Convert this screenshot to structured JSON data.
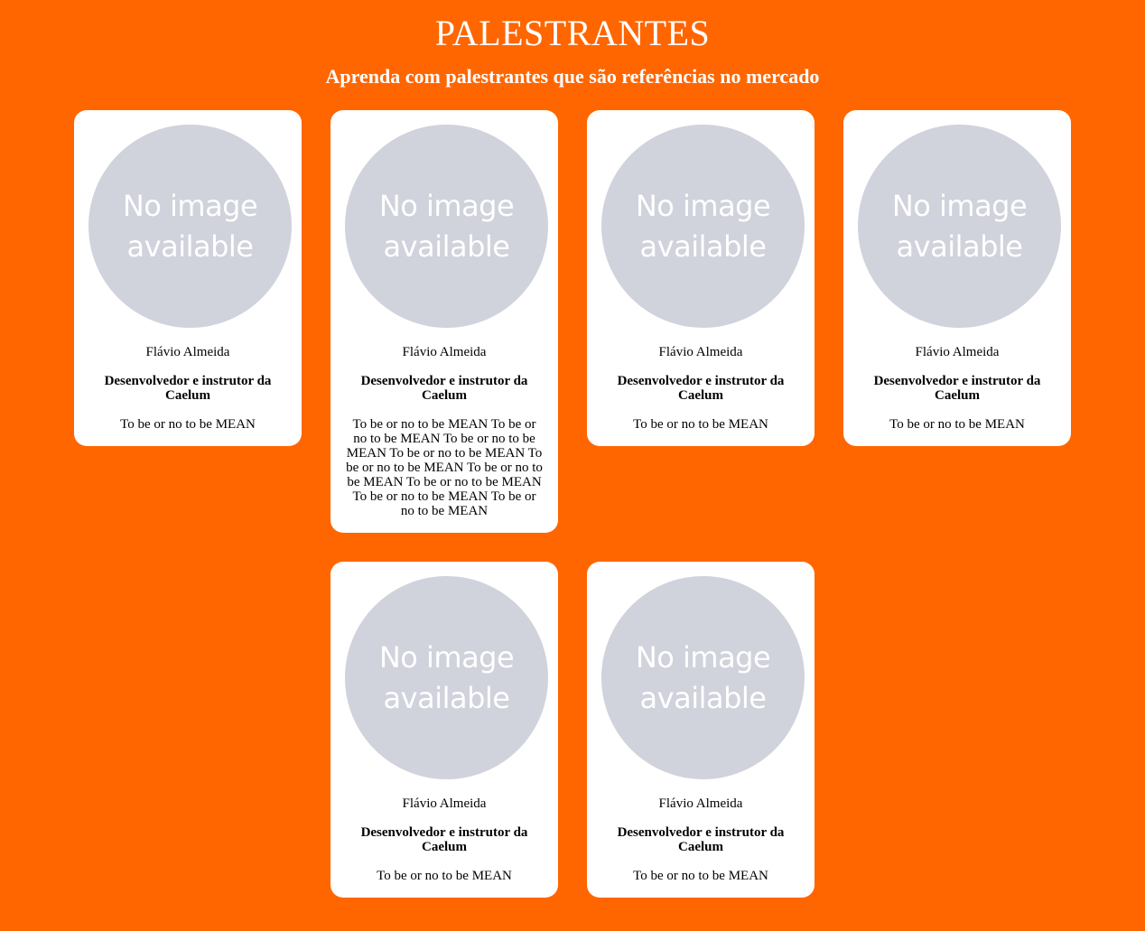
{
  "header": {
    "title": "PALESTRANTES",
    "subtitle": "Aprenda com palestrantes que são referências no mercado"
  },
  "colors": {
    "background": "#ff6600",
    "card": "#ffffff",
    "avatar_placeholder": "#d0d2dc"
  },
  "speakers": [
    {
      "avatar_icon": "no-image-placeholder",
      "avatar_line1": "No image",
      "avatar_line2": "available",
      "name": "Flávio Almeida",
      "role": "Desenvolvedor e instrutor da Caelum",
      "talk": "To be or no to be MEAN"
    },
    {
      "avatar_icon": "no-image-placeholder",
      "avatar_line1": "No image",
      "avatar_line2": "available",
      "name": "Flávio Almeida",
      "role": "Desenvolvedor e instrutor da Caelum",
      "talk": "To be or no to be MEAN To be or no to be MEAN To be or no to be MEAN To be or no to be MEAN To be or no to be MEAN To be or no to be MEAN To be or no to be MEAN To be or no to be MEAN To be or no to be MEAN"
    },
    {
      "avatar_icon": "no-image-placeholder",
      "avatar_line1": "No image",
      "avatar_line2": "available",
      "name": "Flávio Almeida",
      "role": "Desenvolvedor e instrutor da Caelum",
      "talk": "To be or no to be MEAN"
    },
    {
      "avatar_icon": "no-image-placeholder",
      "avatar_line1": "No image",
      "avatar_line2": "available",
      "name": "Flávio Almeida",
      "role": "Desenvolvedor e instrutor da Caelum",
      "talk": "To be or no to be MEAN"
    },
    {
      "avatar_icon": "no-image-placeholder",
      "avatar_line1": "No image",
      "avatar_line2": "available",
      "name": "Flávio Almeida",
      "role": "Desenvolvedor e instrutor da Caelum",
      "talk": "To be or no to be MEAN"
    },
    {
      "avatar_icon": "no-image-placeholder",
      "avatar_line1": "No image",
      "avatar_line2": "available",
      "name": "Flávio Almeida",
      "role": "Desenvolvedor e instrutor da Caelum",
      "talk": "To be or no to be MEAN"
    }
  ]
}
